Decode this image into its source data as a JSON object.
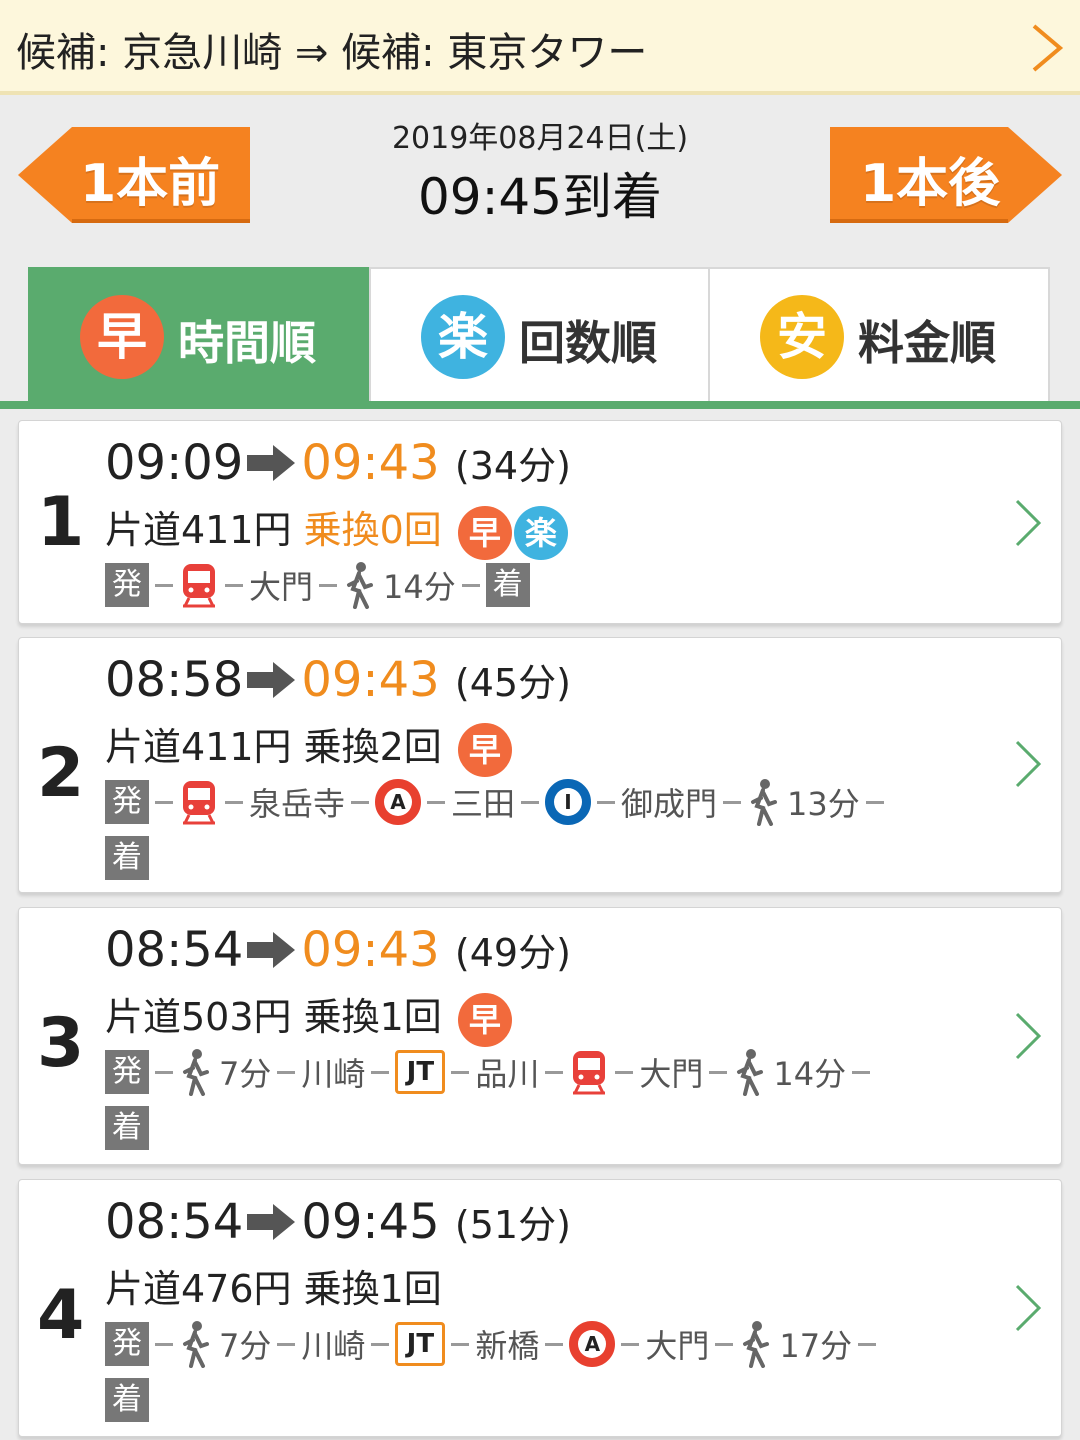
{
  "route": {
    "label": "候補: 京急川崎 ⇒ 候補: 東京タワー"
  },
  "nav": {
    "prev_label": "1本前",
    "next_label": "1本後",
    "date": "2019年08月24日(土)",
    "time": "09:45到着"
  },
  "tabs": [
    {
      "badge": "早",
      "label": "時間順",
      "badge_color": "#f26a3c",
      "active": true
    },
    {
      "badge": "楽",
      "label": "回数順",
      "badge_color": "#3fb3e0",
      "active": false
    },
    {
      "badge": "安",
      "label": "料金順",
      "badge_color": "#f5b819",
      "active": false
    }
  ],
  "colors": {
    "green": "#5aab6e",
    "orange": "#f08c1e",
    "line_a_red": "#e8402f",
    "line_i_blue": "#0a67b5"
  },
  "results": [
    {
      "num": "1",
      "depart": "09:09",
      "arrive": "09:43",
      "duration": "(34分)",
      "fare": "片道411円",
      "transfers": "乗換0回",
      "depart_label": "発",
      "arrive_label": "着",
      "stations": [
        "大門"
      ],
      "walk": "14分"
    },
    {
      "num": "2",
      "depart": "08:58",
      "arrive": "09:43",
      "duration": "(45分)",
      "fare": "片道411円",
      "transfers": "乗換2回",
      "depart_label": "発",
      "arrive_label": "着",
      "stations": [
        "泉岳寺",
        "三田",
        "御成門"
      ],
      "line_marks": [
        "A",
        "I"
      ],
      "walk": "13分"
    },
    {
      "num": "3",
      "depart": "08:54",
      "arrive": "09:43",
      "duration": "(49分)",
      "fare": "片道503円",
      "transfers": "乗換1回",
      "depart_label": "発",
      "arrive_label": "着",
      "walk_first": "7分",
      "stations": [
        "川崎",
        "品川",
        "大門"
      ],
      "line_marks": [
        "JT"
      ],
      "walk": "14分"
    },
    {
      "num": "4",
      "depart": "08:54",
      "arrive": "09:45",
      "duration": "(51分)",
      "fare": "片道476円",
      "transfers": "乗換1回",
      "depart_label": "発",
      "arrive_label": "着",
      "walk_first": "7分",
      "stations": [
        "川崎",
        "新橋",
        "大門"
      ],
      "line_marks": [
        "JT",
        "A"
      ],
      "walk": "17分"
    }
  ],
  "icons": {
    "train": "train-icon",
    "walk": "walk-icon",
    "chevron": "chevron-right-icon",
    "arrow": "arrow-right-icon"
  }
}
